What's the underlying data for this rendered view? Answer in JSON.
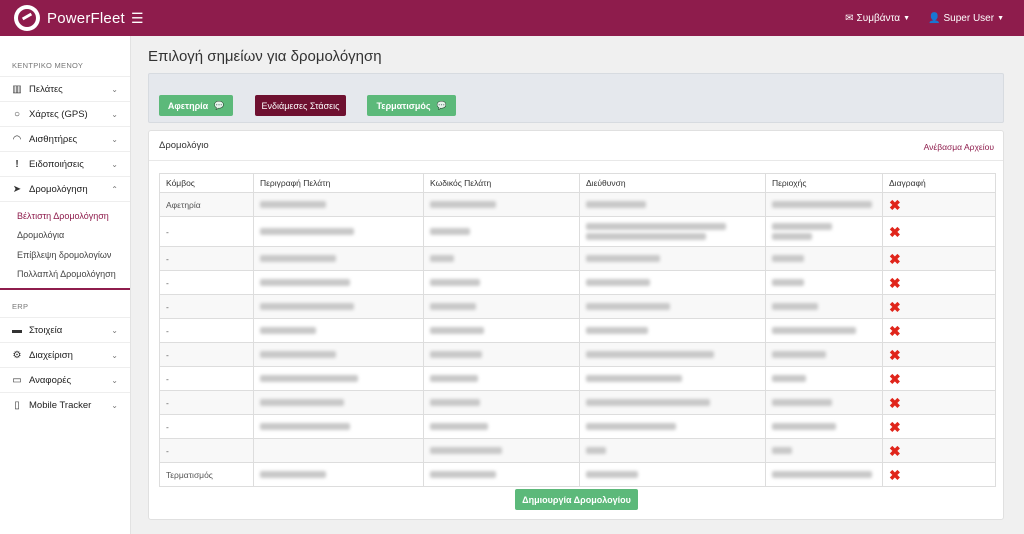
{
  "brand": {
    "name": "PowerFleet"
  },
  "topbar": {
    "events_label": "Συμβάντα",
    "user_label": "Super User"
  },
  "sidebar": {
    "main_title": "ΚΕΝΤΡΙΚΟ ΜΕΝΟΥ",
    "items": [
      {
        "label": "Πελάτες",
        "icon": "map-icon"
      },
      {
        "label": "Χάρτες (GPS)",
        "icon": "circle-icon"
      },
      {
        "label": "Αισθητήρες",
        "icon": "gauge-icon"
      },
      {
        "label": "Ειδοποιήσεις",
        "icon": "exclamation-icon"
      },
      {
        "label": "Δρομολόγηση",
        "icon": "location-arrow-icon"
      }
    ],
    "routing_sub": [
      "Βέλτιστη Δρομολόγηση",
      "Δρομολόγια",
      "Επίβλεψη δρομολογίων",
      "Πολλαπλή Δρομολόγηση"
    ],
    "erp_title": "ERP",
    "erp_items": [
      {
        "label": "Στοιχεία",
        "icon": "truck-icon"
      },
      {
        "label": "Διαχείριση",
        "icon": "gear-icon"
      },
      {
        "label": "Αναφορές",
        "icon": "monitor-icon"
      },
      {
        "label": "Mobile Tracker",
        "icon": "mobile-icon"
      }
    ]
  },
  "page": {
    "title": "Επιλογή σημείων για δρομολόγηση",
    "buttons": {
      "start": "Αφετηρία",
      "stops": "Ενδιάμεσες Στάσεις",
      "end": "Τερματισμός"
    },
    "card_title": "Δρομολόγιο",
    "upload_label": "Ανέβασμα Αρχείου",
    "columns": [
      "Κόμβος",
      "Περιγραφή Πελάτη",
      "Κωδικός Πελάτη",
      "Διεύθυνση",
      "Περιοχής",
      "Διαγραφή"
    ],
    "rows": [
      {
        "node": "Αφετηρία"
      },
      {
        "node": "-"
      },
      {
        "node": "-"
      },
      {
        "node": "-"
      },
      {
        "node": "-"
      },
      {
        "node": "-"
      },
      {
        "node": "-"
      },
      {
        "node": "-"
      },
      {
        "node": "-"
      },
      {
        "node": "-"
      },
      {
        "node": "-"
      },
      {
        "node": "Τερματισμός"
      }
    ],
    "create_label": "Δημιουργία Δρομολογίου"
  },
  "colors": {
    "brand": "#8e1c4c",
    "green": "#5cb97a",
    "delete": "#e0251b"
  }
}
